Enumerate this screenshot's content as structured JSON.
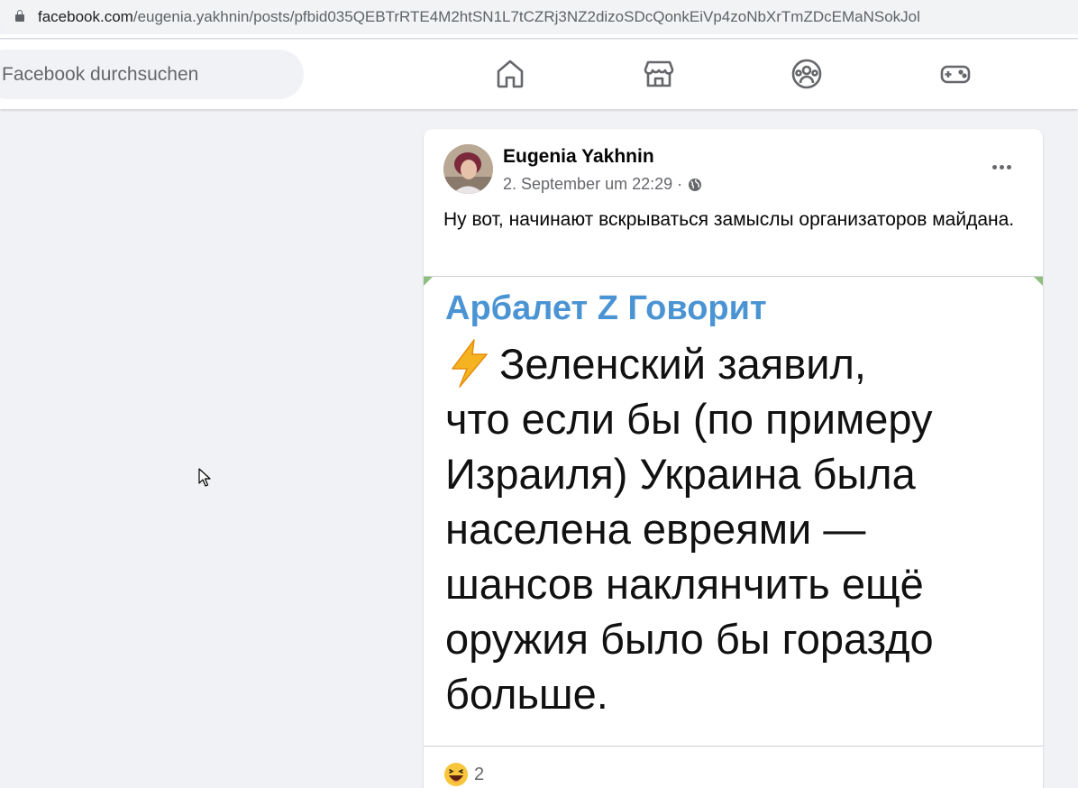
{
  "browser": {
    "url_host": "facebook.com",
    "url_path": "/eugenia.yakhnin/posts/pfbid035QEBTrRTE4M2htSN1L7tCZRj3NZ2dizoSDcQonkEiVp4zoNbXrTmZDcEMaNSokJol"
  },
  "header": {
    "search_placeholder": "Facebook durchsuchen",
    "nav_icons": [
      "home-icon",
      "marketplace-icon",
      "groups-icon",
      "gaming-icon"
    ]
  },
  "post": {
    "author": "Eugenia Yakhnin",
    "timestamp": "2. September um 22:29 ·",
    "text": "Ну вот, начинают вскрываться замыслы организаторов майдана.",
    "image": {
      "channel": "Арбалет Z Говорит",
      "body_line1": "Зеленский заявил,",
      "body_rest": "что если бы (по примеру Израиля) Украина была населена евреями — шансов наклянчить ещё оружия было бы гораздо больше."
    },
    "reaction_count": "2"
  },
  "colors": {
    "page_bg": "#f0f2f5",
    "channel_blue": "#4a94d4",
    "secondary_text": "#65676b"
  }
}
